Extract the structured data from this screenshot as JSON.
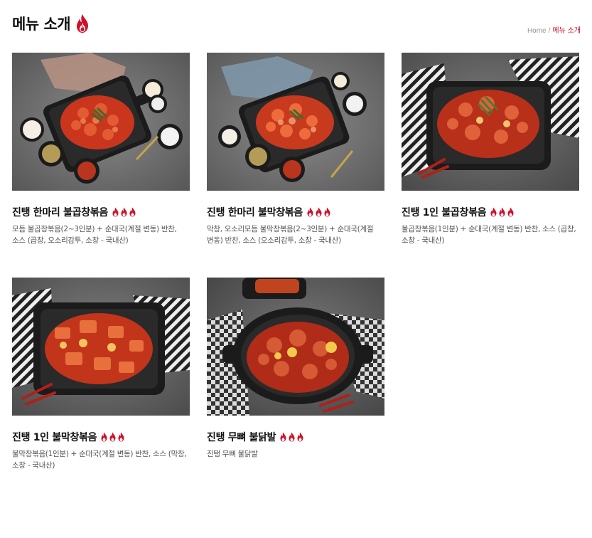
{
  "page": {
    "title": "메뉴 소개",
    "title_icon": "flame-icon",
    "accent_color": "#c8102e"
  },
  "breadcrumb": {
    "home": "Home",
    "separator": "/",
    "current": "메뉴 소개"
  },
  "menu_items": [
    {
      "name": "진탱 한마리 불곱창볶음",
      "description": "모듬 불곱창볶음(2~3인분) + 순대국(계절 변동) 반찬, 소스 (곱창, 오소리감투, 소창 - 국내산)",
      "spice_icons": 3
    },
    {
      "name": "진탱 한마리 불막창볶음",
      "description": "막창, 오소리모듬 불막창볶음(2~3인분) + 순대국(계절 변동) 반찬, 소스 (오소리감투, 소창 - 국내산)",
      "spice_icons": 3
    },
    {
      "name": "진탱 1인 불곱창볶음",
      "description": "불곱창볶음(1인분) + 순대국(계절 변동) 반찬, 소스 (곱창, 소창 - 국내산)",
      "spice_icons": 3
    },
    {
      "name": "진탱 1인 불막창볶음",
      "description": "불막창볶음(1인분) + 순대국(계절 변동) 반찬, 소스 (막창, 소창 - 국내산)",
      "spice_icons": 3
    },
    {
      "name": "진탱 무뼈 불닭발",
      "description": "진탱 무뼈 불닭발",
      "spice_icons": 3
    }
  ]
}
